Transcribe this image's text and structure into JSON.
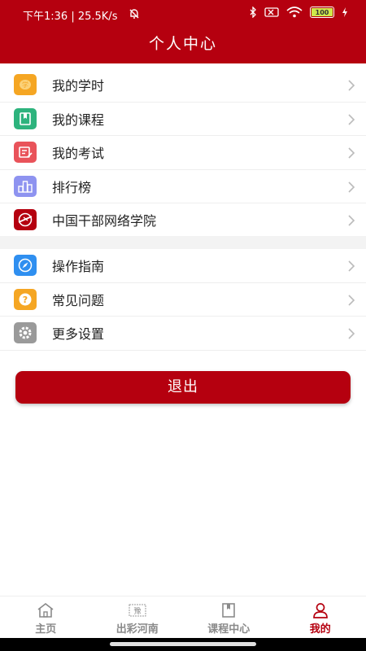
{
  "status_bar": {
    "left_text": "下午1:36 | 25.5K/s",
    "battery": "100"
  },
  "header": {
    "title": "个人中心"
  },
  "menu_primary": [
    {
      "label": "我的学时",
      "icon": "study-hours-icon",
      "color": "#f5a623"
    },
    {
      "label": "我的课程",
      "icon": "book-icon",
      "color": "#2db37d"
    },
    {
      "label": "我的考试",
      "icon": "exam-icon",
      "color": "#e9535a"
    },
    {
      "label": "排行榜",
      "icon": "ranking-icon",
      "color": "#8e93f0"
    },
    {
      "label": "中国干部网络学院",
      "icon": "academy-logo-icon",
      "color": "#b5000f"
    }
  ],
  "menu_secondary": [
    {
      "label": "操作指南",
      "icon": "compass-icon",
      "color": "#2f8ff0"
    },
    {
      "label": "常见问题",
      "icon": "question-icon",
      "color": "#f5a623"
    },
    {
      "label": "更多设置",
      "icon": "settings-icon",
      "color": "#9a9a9a"
    }
  ],
  "logout_label": "退出",
  "tabbar": [
    {
      "label": "主页",
      "icon": "home-icon"
    },
    {
      "label": "出彩河南",
      "icon": "henan-icon"
    },
    {
      "label": "课程中心",
      "icon": "course-book-icon"
    },
    {
      "label": "我的",
      "icon": "person-icon",
      "active": true
    }
  ],
  "colors": {
    "brand": "#b5000f"
  }
}
